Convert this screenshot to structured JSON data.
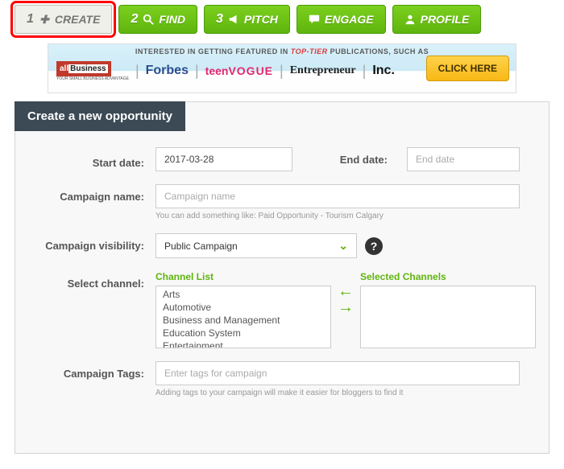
{
  "nav": {
    "create": {
      "num": "1",
      "label": "CREATE"
    },
    "find": {
      "num": "2",
      "label": "FIND"
    },
    "pitch": {
      "num": "3",
      "label": "PITCH"
    },
    "engage": {
      "label": "ENGAGE"
    },
    "profile": {
      "label": "PROFILE"
    }
  },
  "banner": {
    "prefix": "INTERESTED IN GETTING FEATURED IN",
    "top_tier": "TOP-TIER",
    "suffix": "PUBLICATIONS, SUCH AS",
    "logos": {
      "all_prefix": "all",
      "all_biz": "Business",
      "all_sub": "YOUR SMALL BUSINESS ADVANTAGE",
      "forbes": "Forbes",
      "teen": "teen",
      "vogue": "VOGUE",
      "entrepreneur": "Entrepreneur",
      "inc": "Inc."
    },
    "cta": "CLICK HERE"
  },
  "panel": {
    "title": "Create a new opportunity"
  },
  "form": {
    "start_date": {
      "label": "Start date:",
      "value": "2017-03-28"
    },
    "end_date": {
      "label": "End date:",
      "placeholder": "End date"
    },
    "campaign_name": {
      "label": "Campaign name:",
      "placeholder": "Campaign name",
      "helper": "You can add something like: Paid Opportunity - Tourism Calgary"
    },
    "visibility": {
      "label": "Campaign visibility:",
      "value": "Public Campaign"
    },
    "channel": {
      "label": "Select channel:",
      "list_title": "Channel List",
      "selected_title": "Selected Channels",
      "options": [
        "Arts",
        "Automotive",
        "Business and Management",
        "Education System",
        "Entertainment"
      ]
    },
    "tags": {
      "label": "Campaign Tags:",
      "placeholder": "Enter tags for campaign",
      "helper": "Adding tags to your campaign will make it easier for bloggers to find it"
    }
  }
}
